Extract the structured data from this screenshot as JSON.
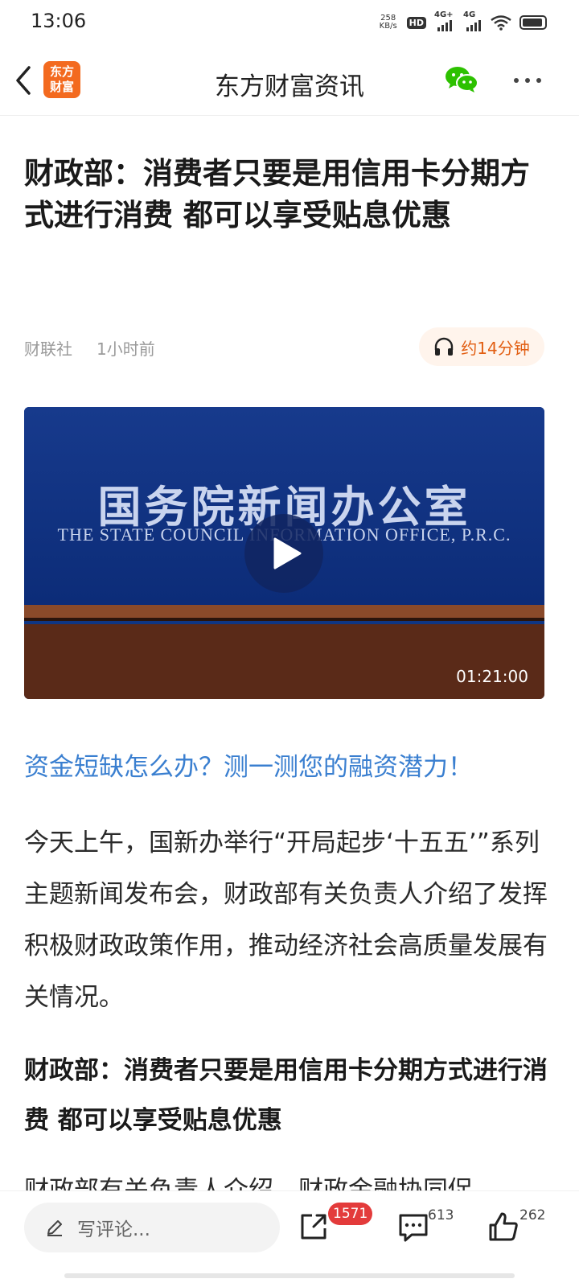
{
  "status_bar": {
    "time": "13:06",
    "net_speed_value": "258",
    "net_speed_unit": "KB/s",
    "hd_label": "HD",
    "signal1_label": "4G+",
    "signal2_label": "4G",
    "icons": [
      "hd-icon",
      "signal-icon",
      "signal-icon",
      "wifi-icon",
      "battery-icon"
    ]
  },
  "nav": {
    "title": "东方财富资讯",
    "logo_line1": "东方",
    "logo_line2": "财富",
    "icons": [
      "back-icon",
      "wechat-icon",
      "more-icon"
    ],
    "wechat_color": "#2dc100",
    "logo_color": "#f36a1f"
  },
  "article": {
    "title": "财政部：消费者只要是用信用卡分期方式进行消费 都可以享受贴息优惠",
    "source": "财联社",
    "time": "1小时前",
    "listen_label": "约14分钟",
    "video": {
      "cn_text": "国务院新闻办公室",
      "en_text": "THE STATE COUNCIL INFORMATION OFFICE, P.R.C.",
      "duration": "01:21:00"
    },
    "promo_link": "资金短缺怎么办？测一测您的融资潜力！",
    "paragraph": "今天上午，国新办举行“开局起步‘十五五’”系列主题新闻发布会，财政部有关负责人介绍了发挥积极财政政策作用，推动经济社会高质量发展有关情况。",
    "subheading": "财政部：消费者只要是用信用卡分期方式进行消费 都可以享受贴息优惠",
    "next_text": "财政部有关负责人介绍，财政金融协同促"
  },
  "bottom_bar": {
    "comment_placeholder": "写评论...",
    "share_count": "1571",
    "comment_count": "613",
    "like_count": "262",
    "accent_color": "#e33b3b"
  }
}
